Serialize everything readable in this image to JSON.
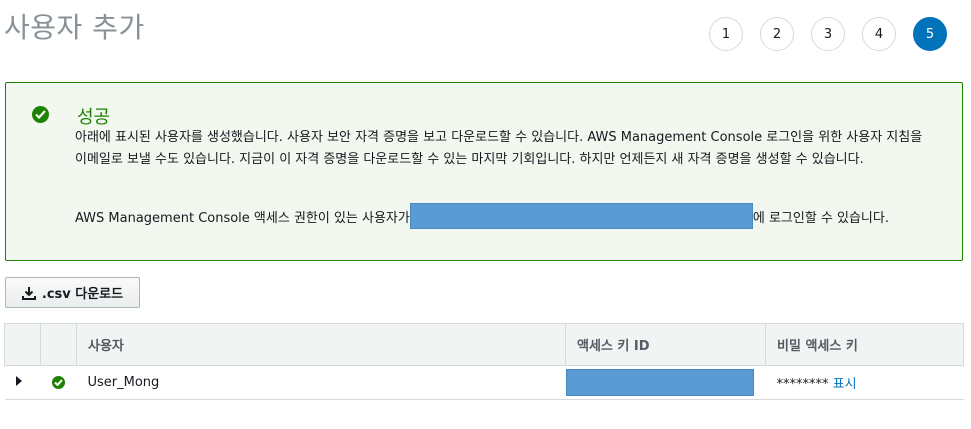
{
  "page": {
    "title": "사용자 추가"
  },
  "steps": [
    "1",
    "2",
    "3",
    "4",
    "5"
  ],
  "success": {
    "title": "성공",
    "message": "아래에 표시된 사용자를 생성했습니다. 사용자 보안 자격 증명을 보고 다운로드할 수 있습니다. AWS Management Console 로그인을 위한 사용자 지침을 이메일로 보낼 수도 있습니다. 지금이 이 자격 증명을 다운로드할 수 있는 마지막 기회입니다. 하지만 언제든지 새 자격 증명을 생성할 수 있습니다.",
    "signin_prefix": "AWS Management Console 액세스 권한이 있는 사용자가",
    "signin_suffix": "에 로그인할 수 있습니다."
  },
  "csv_button": {
    "label": ".csv 다운로드",
    "icon": "download-icon"
  },
  "table": {
    "headers": {
      "user": "사용자",
      "access_key_id": "액세스 키 ID",
      "secret_key": "비밀 액세스 키"
    },
    "rows": [
      {
        "user": "User_Mong",
        "secret_mask": "********",
        "show_label": "표시"
      }
    ]
  },
  "colors": {
    "success": "#1d8102",
    "accent": "#0073bb",
    "redaction": "#5a9bd5"
  }
}
